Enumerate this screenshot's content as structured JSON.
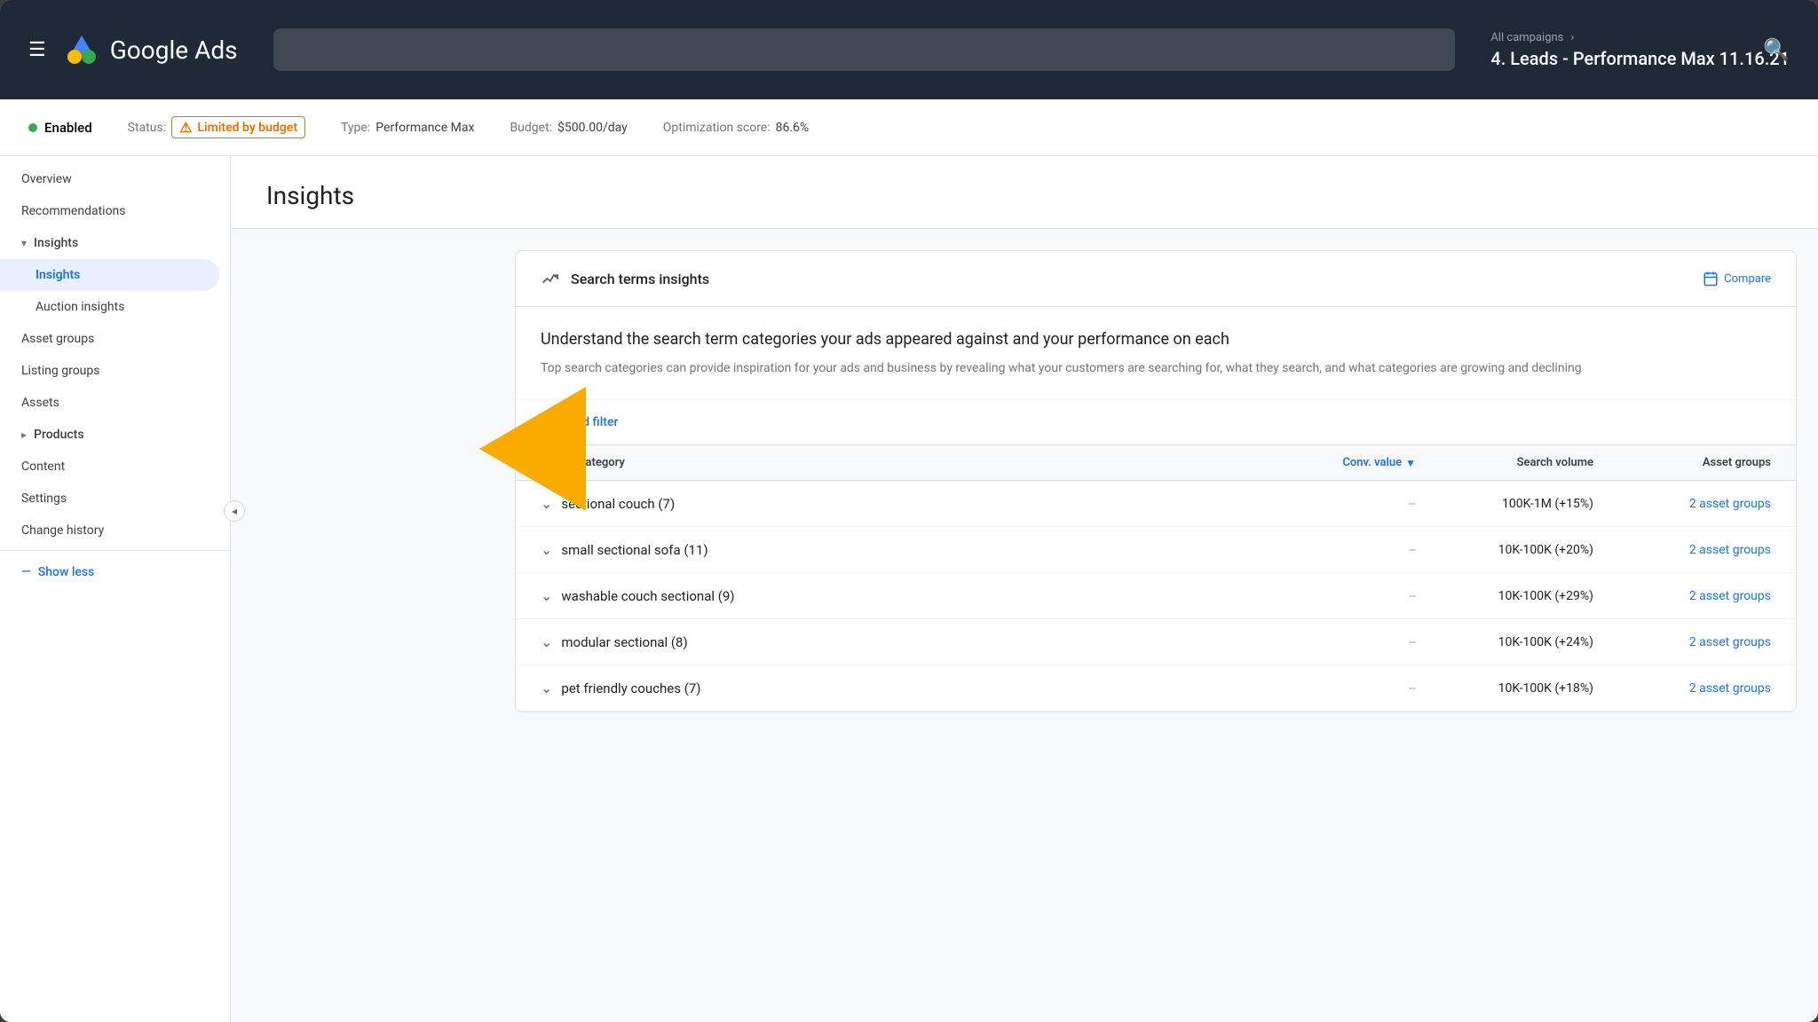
{
  "app": {
    "title": "Google Ads",
    "search_placeholder": "Search"
  },
  "breadcrumb": {
    "parent": "All campaigns",
    "current": "4. Leads - Performance Max 11.16.21"
  },
  "statusbar": {
    "enabled_label": "Enabled",
    "status_label": "Status:",
    "limited_budget": "Limited by budget",
    "type_label": "Type:",
    "type_value": "Performance Max",
    "budget_label": "Budget:",
    "budget_value": "$500.00/day",
    "optimization_label": "Optimization score:",
    "optimization_value": "86.6%"
  },
  "sidebar": {
    "overview": "Overview",
    "recommendations": "Recommendations",
    "insights_toggle": "Insights",
    "insights_child": "Insights",
    "auction_insights": "Auction insights",
    "asset_groups": "Asset groups",
    "listing_groups": "Listing groups",
    "assets": "Assets",
    "products_toggle": "Products",
    "content": "Content",
    "settings": "Settings",
    "change_history": "Change history",
    "show_less": "Show less"
  },
  "page": {
    "title": "Insights"
  },
  "panel": {
    "header_title": "Search terms insights",
    "compare_label": "Compare",
    "desc_title": "Understand the search term categories your ads appeared against and your performance on each",
    "desc_subtitle": "Top search categories can provide inspiration for your ads and business by revealing what your customers are searching for, what they search, and what categories are growing and declining",
    "filter_label": "Add filter",
    "columns": {
      "search_category": "Search category",
      "conv_value": "Conv. value",
      "search_volume": "Search volume",
      "asset_groups": "Asset groups"
    },
    "rows": [
      {
        "category": "sectional couch (7)",
        "conv_value": "--",
        "search_volume": "100K-1M (+15%)",
        "asset_groups": "2 asset groups"
      },
      {
        "category": "small sectional sofa (11)",
        "conv_value": "--",
        "search_volume": "10K-100K (+20%)",
        "asset_groups": "2 asset groups"
      },
      {
        "category": "washable couch sectional (9)",
        "conv_value": "--",
        "search_volume": "10K-100K (+29%)",
        "asset_groups": "2 asset groups"
      },
      {
        "category": "modular sectional (8)",
        "conv_value": "--",
        "search_volume": "10K-100K (+24%)",
        "asset_groups": "2 asset groups"
      },
      {
        "category": "pet friendly couches (7)",
        "conv_value": "--",
        "search_volume": "10K-100K (+18%)",
        "asset_groups": "2 asset groups"
      }
    ]
  },
  "icons": {
    "hamburger": "☰",
    "search": "🔍",
    "chevron_right": "›",
    "chevron_down": "⌄",
    "sort_down": "▼",
    "filter": "⊟",
    "calendar": "📅",
    "trend": "⟋",
    "minus": "—",
    "collapse": "◂"
  },
  "colors": {
    "primary_blue": "#1a73e8",
    "topbar_bg": "#1f2937",
    "accent_yellow": "#f9ab00",
    "status_orange": "#e37400",
    "green": "#34a853",
    "text_dark": "#202124",
    "text_medium": "#3c4043",
    "text_light": "#70757a"
  }
}
